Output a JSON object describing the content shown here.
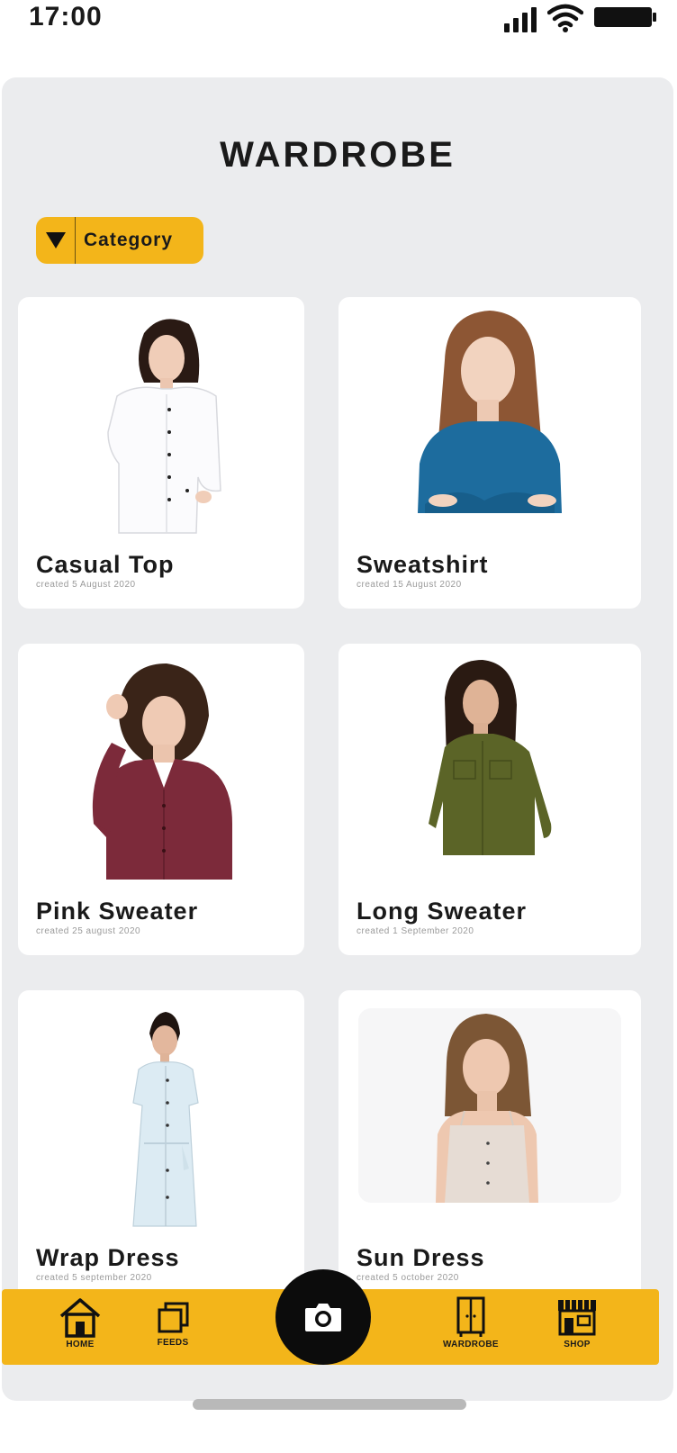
{
  "status_bar": {
    "time": "17:00",
    "icons": [
      "signal-icon",
      "wifi-icon",
      "battery-icon"
    ]
  },
  "header": {
    "title": "WARDROBE"
  },
  "filter": {
    "label": "Category",
    "icon": "dropdown-triangle-icon"
  },
  "items": [
    {
      "name": "Casual Top",
      "date": "created 5 August 2020",
      "image": "woman-white-shirt"
    },
    {
      "name": "Sweatshirt",
      "date": "created 15 August 2020",
      "image": "woman-blue-top"
    },
    {
      "name": "Pink Sweater",
      "date": "created 25 august 2020",
      "image": "woman-maroon-sweater"
    },
    {
      "name": "Long Sweater",
      "date": "created 1 September 2020",
      "image": "woman-green-shirt"
    },
    {
      "name": "Wrap Dress",
      "date": "created 5 september 2020",
      "image": "woman-light-blue-dress"
    },
    {
      "name": "Sun Dress",
      "date": "created 5 october 2020",
      "image": "woman-beige-dress"
    }
  ],
  "nav": {
    "home": "HOME",
    "feeds": "FEEDS",
    "wardrobe": "WARDROBE",
    "shop": "SHOP",
    "camera_icon": "camera-icon"
  },
  "colors": {
    "accent": "#f3b51a",
    "panel": "#ebecee",
    "card": "#ffffff",
    "text": "#1a1a1a"
  }
}
